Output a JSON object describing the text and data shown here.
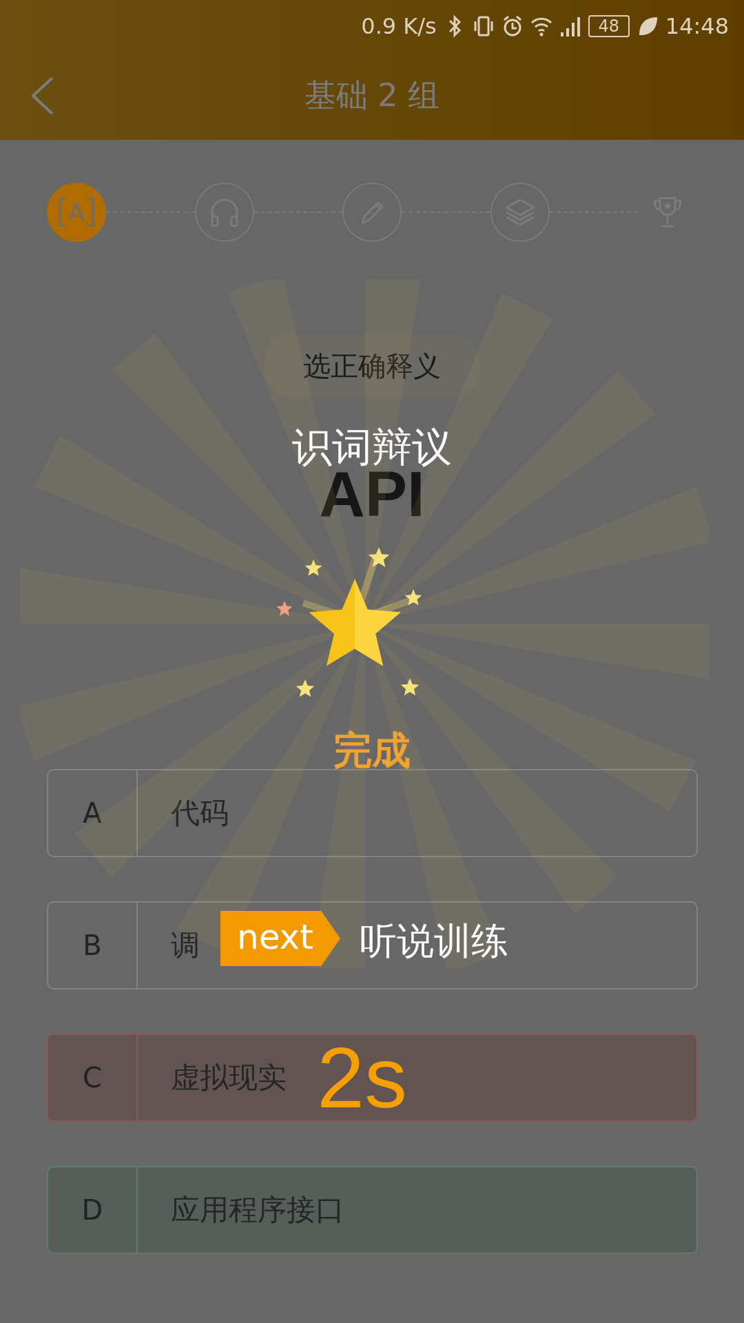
{
  "status_bar": {
    "speed": "0.9 K/s",
    "battery": "48",
    "time": "14:48"
  },
  "header": {
    "title": "基础 2 组"
  },
  "steps": [
    {
      "kind": "word",
      "label": "A",
      "active": true
    },
    {
      "kind": "listen",
      "active": false
    },
    {
      "kind": "write",
      "active": false
    },
    {
      "kind": "layers",
      "active": false
    },
    {
      "kind": "trophy",
      "active": false
    }
  ],
  "prompt": "选正确释义",
  "word": "API",
  "options": [
    {
      "letter": "A",
      "text": "代码",
      "wrong": false,
      "correct": false
    },
    {
      "letter": "B",
      "text": "调",
      "wrong": false,
      "correct": false
    },
    {
      "letter": "C",
      "text": "虚拟现实",
      "wrong": true,
      "correct": false,
      "countdown": "2s"
    },
    {
      "letter": "D",
      "text": "应用程序接口",
      "wrong": false,
      "correct": true
    }
  ],
  "overlay": {
    "stage": "识词辩议",
    "done": "完成",
    "next_tag": "next",
    "next_stage": "听说训练"
  }
}
